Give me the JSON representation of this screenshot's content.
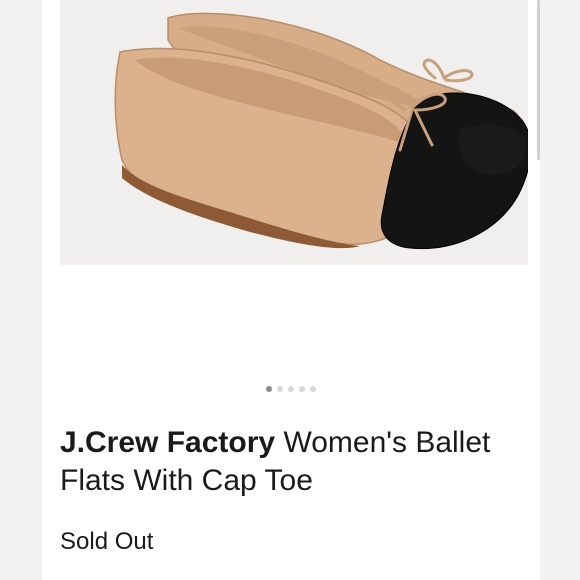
{
  "product": {
    "brand": "J.Crew Factory",
    "name": "Women's Ballet Flats With Cap Toe",
    "status": "Sold Out"
  },
  "carousel": {
    "total_images": 5,
    "active_index": 0
  },
  "colors": {
    "tan": "#d8b08c",
    "black": "#111111",
    "image_bg": "#f1efee"
  }
}
